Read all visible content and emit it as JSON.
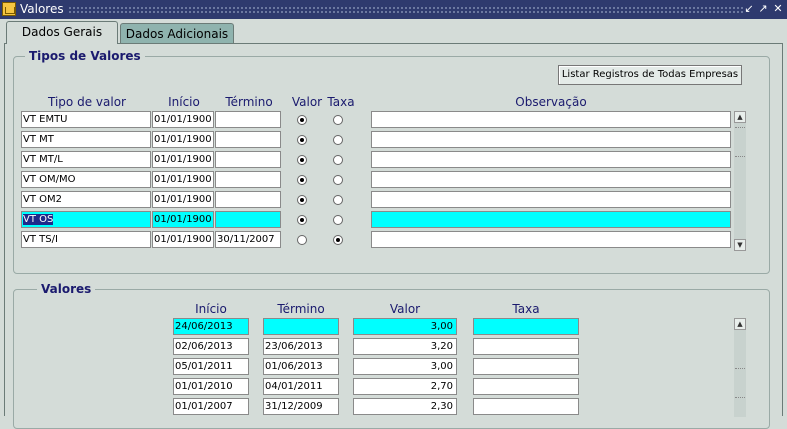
{
  "window": {
    "title": "Valores"
  },
  "tabs": [
    {
      "label": "Dados Gerais"
    },
    {
      "label": "Dados Adicionais"
    }
  ],
  "tipos": {
    "title": "Tipos de Valores",
    "listar_button": "Listar Registros de Todas Empresas",
    "headers": {
      "tipo": "Tipo de valor",
      "inicio": "Início",
      "termino": "Término",
      "valor": "Valor",
      "taxa": "Taxa",
      "obs": "Observação"
    },
    "rows": [
      {
        "tipo": "VT EMTU",
        "inicio": "01/01/1900",
        "termino": "",
        "valor_on": true,
        "obs": ""
      },
      {
        "tipo": "VT MT",
        "inicio": "01/01/1900",
        "termino": "",
        "valor_on": true,
        "obs": ""
      },
      {
        "tipo": "VT MT/L",
        "inicio": "01/01/1900",
        "termino": "",
        "valor_on": true,
        "obs": ""
      },
      {
        "tipo": "VT OM/MO",
        "inicio": "01/01/1900",
        "termino": "",
        "valor_on": true,
        "obs": ""
      },
      {
        "tipo": "VT OM2",
        "inicio": "01/01/1900",
        "termino": "",
        "valor_on": true,
        "obs": ""
      },
      {
        "tipo": "VT OS",
        "inicio": "01/01/1900",
        "termino": "",
        "valor_on": true,
        "obs": ""
      },
      {
        "tipo": "VT TS/I",
        "inicio": "01/01/1900",
        "termino": "30/11/2007",
        "valor_on": false,
        "obs": ""
      }
    ]
  },
  "valores": {
    "title": "Valores",
    "headers": {
      "inicio": "Início",
      "termino": "Término",
      "valor": "Valor",
      "taxa": "Taxa"
    },
    "rows": [
      {
        "inicio": "24/06/2013",
        "termino": "",
        "valor": "3,00",
        "taxa": ""
      },
      {
        "inicio": "02/06/2013",
        "termino": "23/06/2013",
        "valor": "3,20",
        "taxa": ""
      },
      {
        "inicio": "05/01/2011",
        "termino": "01/06/2013",
        "valor": "3,00",
        "taxa": ""
      },
      {
        "inicio": "01/01/2010",
        "termino": "04/01/2011",
        "valor": "2,70",
        "taxa": ""
      },
      {
        "inicio": "01/01/2007",
        "termino": "31/12/2009",
        "valor": "2,30",
        "taxa": ""
      }
    ]
  },
  "colors": {
    "titlebar": "#2e3a6e",
    "selected_row": "#00ffff",
    "header_text": "#1a1a6e",
    "background": "#d4dcd8"
  }
}
